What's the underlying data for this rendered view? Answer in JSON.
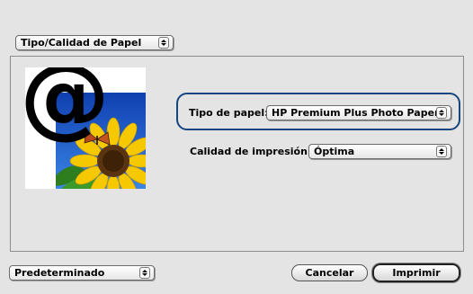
{
  "panel_selector": {
    "value": "Tipo/Calidad de Papel"
  },
  "paper_type": {
    "label": "Tipo de papel:",
    "value": "HP Premium Plus Photo Paper"
  },
  "print_quality": {
    "label": "Calidad de impresión:",
    "value": "Óptima"
  },
  "presets": {
    "value": "Predeterminado"
  },
  "buttons": {
    "cancel": "Cancelar",
    "print": "Imprimir"
  },
  "preview": {
    "symbol": "@"
  },
  "colors": {
    "highlight": "#17457e",
    "sky": "#1a56c8",
    "petal": "#f5c800"
  }
}
